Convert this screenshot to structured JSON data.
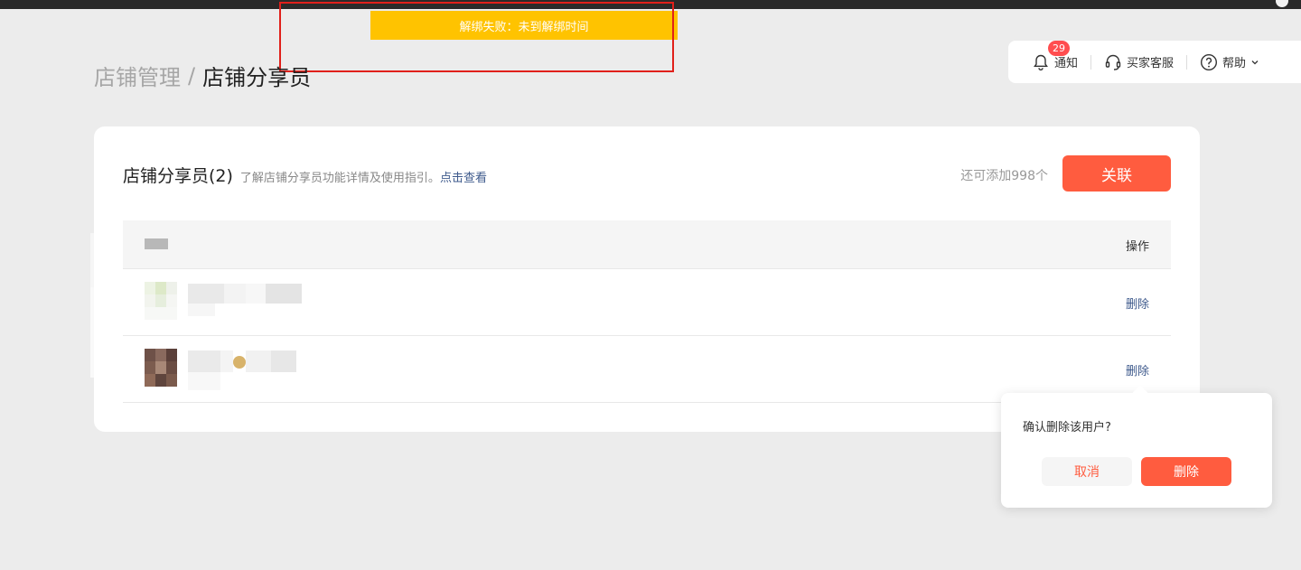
{
  "toast": {
    "message": "解绑失败：未到解绑时间"
  },
  "breadcrumb": {
    "parent": "店铺管理",
    "separator": "/",
    "current": "店铺分享员"
  },
  "header_actions": {
    "notify_label": "通知",
    "notify_count": "29",
    "service_label": "买家客服",
    "help_label": "帮助"
  },
  "card": {
    "title": "店铺分享员(2)",
    "hint": "了解店铺分享员功能详情及使用指引。",
    "hint_link": "点击查看",
    "remain": "还可添加998个",
    "link_button": "关联"
  },
  "table": {
    "col_op": "操作",
    "rows": [
      {
        "delete_label": "删除"
      },
      {
        "delete_label": "删除"
      }
    ]
  },
  "popconfirm": {
    "message": "确认删除该用户?",
    "cancel": "取消",
    "confirm": "删除"
  },
  "colors": {
    "primary": "#ff5c3f",
    "toast_bg": "#ffc300",
    "link": "#3e5a8c",
    "badge": "#ff4d4f"
  }
}
